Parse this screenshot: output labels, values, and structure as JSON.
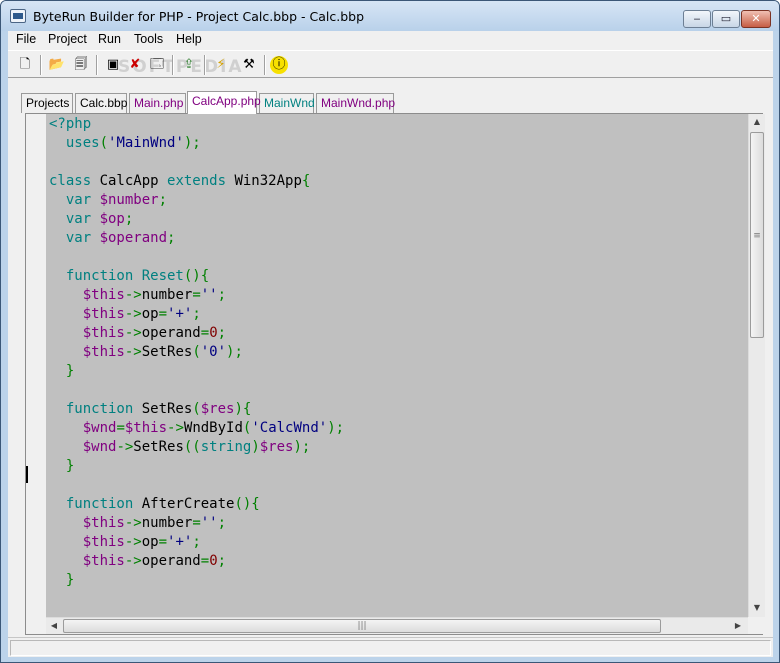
{
  "window": {
    "title": "ByteRun Builder for PHP - Project Calc.bbp - Calc.bbp",
    "buttons": {
      "minimize": "‒",
      "maximize": "▭",
      "close": "✕"
    }
  },
  "menubar": {
    "items": [
      "File",
      "Project",
      "Run",
      "Tools",
      "Help"
    ]
  },
  "toolbar": {
    "watermark": "SOFTPEDIA",
    "buttons": [
      {
        "name": "new-file-icon",
        "glyph": "🗋"
      },
      {
        "name": "open-folder-icon",
        "glyph": "📂"
      },
      {
        "name": "save-all-icon",
        "glyph": "🗐"
      },
      {
        "name": "add-form-icon",
        "glyph": "▣"
      },
      {
        "name": "delete-icon",
        "glyph": "✘"
      },
      {
        "name": "window-icon",
        "glyph": "🗔"
      },
      {
        "name": "export-icon",
        "glyph": "⇪"
      },
      {
        "name": "run-icon",
        "glyph": "⚡"
      },
      {
        "name": "build-tools-icon",
        "glyph": "⚒"
      },
      {
        "name": "info-icon",
        "glyph": "ⓘ"
      }
    ]
  },
  "tabs": [
    {
      "label": "Projects",
      "color": "#000000"
    },
    {
      "label": "Calc.bbp",
      "color": "#000000"
    },
    {
      "label": "Main.php",
      "color": "#800080"
    },
    {
      "label": "CalcApp.php",
      "color": "#800080"
    },
    {
      "label": "MainWnd",
      "color": "#008080"
    },
    {
      "label": "MainWnd.php",
      "color": "#800080"
    }
  ],
  "active_tab": "CalcApp.php",
  "code": {
    "lines": [
      [
        [
          "t-tag",
          "<?php"
        ]
      ],
      [
        [
          "t-id",
          "  "
        ],
        [
          "t-kw",
          "uses"
        ],
        [
          "t-sym",
          "("
        ],
        [
          "t-str",
          "'MainWnd'"
        ],
        [
          "t-sym",
          ");"
        ]
      ],
      [],
      [
        [
          "t-kw",
          "class "
        ],
        [
          "t-id",
          "CalcApp "
        ],
        [
          "t-kw",
          "extends "
        ],
        [
          "t-id",
          "Win32App"
        ],
        [
          "t-sym",
          "{"
        ]
      ],
      [
        [
          "t-id",
          "  "
        ],
        [
          "t-kw",
          "var "
        ],
        [
          "t-var",
          "$number"
        ],
        [
          "t-sym",
          ";"
        ]
      ],
      [
        [
          "t-id",
          "  "
        ],
        [
          "t-kw",
          "var "
        ],
        [
          "t-var",
          "$op"
        ],
        [
          "t-sym",
          ";"
        ]
      ],
      [
        [
          "t-id",
          "  "
        ],
        [
          "t-kw",
          "var "
        ],
        [
          "t-var",
          "$operand"
        ],
        [
          "t-sym",
          ";"
        ]
      ],
      [],
      [
        [
          "t-id",
          "  "
        ],
        [
          "t-kw",
          "function "
        ],
        [
          "t-fn",
          "Reset"
        ],
        [
          "t-sym",
          "(){"
        ]
      ],
      [
        [
          "t-id",
          "    "
        ],
        [
          "t-var",
          "$this"
        ],
        [
          "t-sym",
          "->"
        ],
        [
          "t-id",
          "number"
        ],
        [
          "t-sym",
          "="
        ],
        [
          "t-str",
          "''"
        ],
        [
          "t-sym",
          ";"
        ]
      ],
      [
        [
          "t-id",
          "    "
        ],
        [
          "t-var",
          "$this"
        ],
        [
          "t-sym",
          "->"
        ],
        [
          "t-id",
          "op"
        ],
        [
          "t-sym",
          "="
        ],
        [
          "t-str",
          "'+'"
        ],
        [
          "t-sym",
          ";"
        ]
      ],
      [
        [
          "t-id",
          "    "
        ],
        [
          "t-var",
          "$this"
        ],
        [
          "t-sym",
          "->"
        ],
        [
          "t-id",
          "operand"
        ],
        [
          "t-sym",
          "="
        ],
        [
          "t-num",
          "0"
        ],
        [
          "t-sym",
          ";"
        ]
      ],
      [
        [
          "t-id",
          "    "
        ],
        [
          "t-var",
          "$this"
        ],
        [
          "t-sym",
          "->"
        ],
        [
          "t-id",
          "SetRes"
        ],
        [
          "t-sym",
          "("
        ],
        [
          "t-str",
          "'0'"
        ],
        [
          "t-sym",
          ");"
        ]
      ],
      [
        [
          "t-id",
          "  "
        ],
        [
          "t-sym",
          "}"
        ]
      ],
      [],
      [
        [
          "t-id",
          "  "
        ],
        [
          "t-kw",
          "function "
        ],
        [
          "t-id",
          "SetRes"
        ],
        [
          "t-sym",
          "("
        ],
        [
          "t-var",
          "$res"
        ],
        [
          "t-sym",
          "){"
        ]
      ],
      [
        [
          "t-id",
          "    "
        ],
        [
          "t-var",
          "$wnd"
        ],
        [
          "t-sym",
          "="
        ],
        [
          "t-var",
          "$this"
        ],
        [
          "t-sym",
          "->"
        ],
        [
          "t-id",
          "WndById"
        ],
        [
          "t-sym",
          "("
        ],
        [
          "t-str",
          "'CalcWnd'"
        ],
        [
          "t-sym",
          ");"
        ]
      ],
      [
        [
          "t-id",
          "    "
        ],
        [
          "t-var",
          "$wnd"
        ],
        [
          "t-sym",
          "->"
        ],
        [
          "t-id",
          "SetRes"
        ],
        [
          "t-sym",
          "(("
        ],
        [
          "t-kw",
          "string"
        ],
        [
          "t-sym",
          ")"
        ],
        [
          "t-var",
          "$res"
        ],
        [
          "t-sym",
          ");"
        ]
      ],
      [
        [
          "t-id",
          "  "
        ],
        [
          "t-sym",
          "}"
        ]
      ],
      [],
      [
        [
          "t-id",
          "  "
        ],
        [
          "t-kw",
          "function "
        ],
        [
          "t-id",
          "AfterCreate"
        ],
        [
          "t-sym",
          "(){"
        ]
      ],
      [
        [
          "t-id",
          "    "
        ],
        [
          "t-var",
          "$this"
        ],
        [
          "t-sym",
          "->"
        ],
        [
          "t-id",
          "number"
        ],
        [
          "t-sym",
          "="
        ],
        [
          "t-str",
          "''"
        ],
        [
          "t-sym",
          ";"
        ]
      ],
      [
        [
          "t-id",
          "    "
        ],
        [
          "t-var",
          "$this"
        ],
        [
          "t-sym",
          "->"
        ],
        [
          "t-id",
          "op"
        ],
        [
          "t-sym",
          "="
        ],
        [
          "t-str",
          "'+'"
        ],
        [
          "t-sym",
          ";"
        ]
      ],
      [
        [
          "t-id",
          "    "
        ],
        [
          "t-var",
          "$this"
        ],
        [
          "t-sym",
          "->"
        ],
        [
          "t-id",
          "operand"
        ],
        [
          "t-sym",
          "="
        ],
        [
          "t-num",
          "0"
        ],
        [
          "t-sym",
          ";"
        ]
      ],
      [
        [
          "t-id",
          "  "
        ],
        [
          "t-sym",
          "}"
        ]
      ]
    ]
  },
  "scrollbars": {
    "up": "▲",
    "down": "▼",
    "left": "◀",
    "right": "▶",
    "grip_v": "≡",
    "grip_h": "|||"
  }
}
